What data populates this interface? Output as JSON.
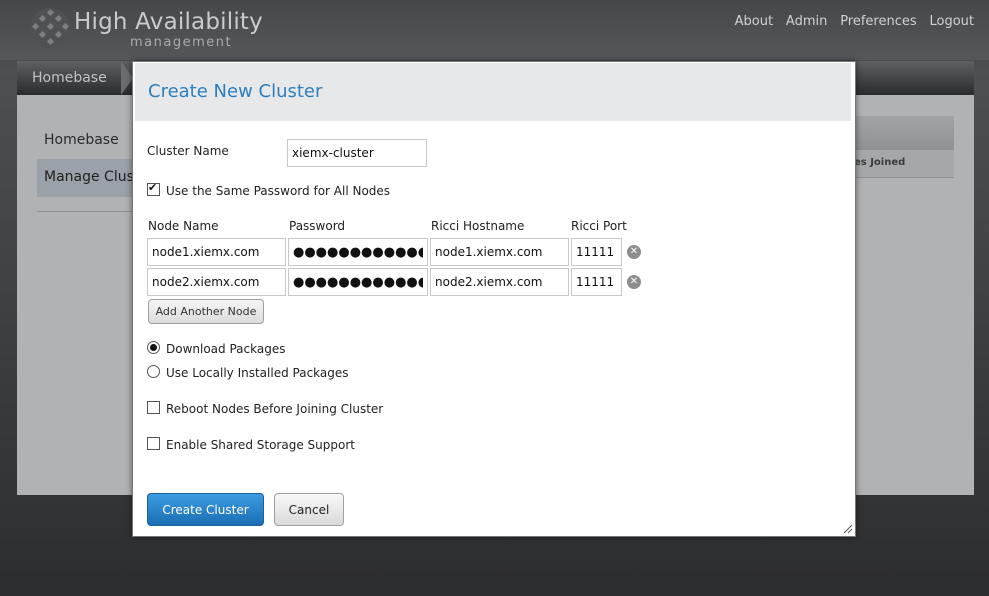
{
  "app": {
    "title": "High Availability",
    "subtitle": "management"
  },
  "topnav": [
    "About",
    "Admin",
    "Preferences",
    "Logout"
  ],
  "breadcrumb": "Homebase",
  "sidebar": {
    "items": [
      {
        "label": "Homebase"
      },
      {
        "label": "Manage Clus"
      }
    ]
  },
  "background_table": {
    "column_fragment": "es Joined"
  },
  "dialog": {
    "title": "Create New Cluster",
    "cluster_name_label": "Cluster Name",
    "cluster_name_value": "xiemx-cluster",
    "same_password_label": "Use the Same Password for All Nodes",
    "same_password_checked": true,
    "columns": [
      "Node Name",
      "Password",
      "Ricci Hostname",
      "Ricci Port"
    ],
    "nodes": [
      {
        "name": "node1.xiemx.com",
        "password": "●●●●●●●●●●●●●",
        "hostname": "node1.xiemx.com",
        "port": "11111"
      },
      {
        "name": "node2.xiemx.com",
        "password": "●●●●●●●●●●●●●",
        "hostname": "node2.xiemx.com",
        "port": "11111"
      }
    ],
    "add_node_label": "Add Another Node",
    "package_options": [
      {
        "label": "Download Packages",
        "selected": true
      },
      {
        "label": "Use Locally Installed Packages",
        "selected": false
      }
    ],
    "reboot_label": "Reboot Nodes Before Joining Cluster",
    "reboot_checked": false,
    "shared_storage_label": "Enable Shared Storage Support",
    "shared_storage_checked": false,
    "create_label": "Create Cluster",
    "cancel_label": "Cancel"
  },
  "colors": {
    "accent_blue": "#2c7fbf",
    "primary_button": "#1b6eb5",
    "header_bg": "#4a4c4f"
  }
}
